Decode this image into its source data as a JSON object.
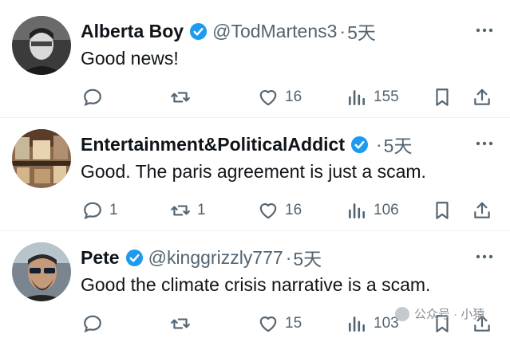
{
  "tweets": [
    {
      "name": "Alberta Boy",
      "handle": "@TodMartens3",
      "separator": "·",
      "time": "5天",
      "text": "Good news!",
      "replies": "",
      "retweets": "",
      "likes": "16",
      "views": "155"
    },
    {
      "name": "Entertainment&PoliticalAddict",
      "handle": "",
      "separator": "·",
      "time": "5天",
      "text": "Good. The paris agreement is just a scam.",
      "replies": "1",
      "retweets": "1",
      "likes": "16",
      "views": "106"
    },
    {
      "name": "Pete",
      "handle": "@kinggrizzly777",
      "separator": "·",
      "time": "5天",
      "text": "Good the climate crisis narrative is a scam.",
      "replies": "",
      "retweets": "",
      "likes": "15",
      "views": "103"
    }
  ],
  "watermark": "公众号 · 小猿",
  "colors": {
    "verified": "#1d9bf0",
    "text": "#0f1419",
    "secondary": "#536471",
    "divider": "#eff3f4"
  },
  "icons": [
    "verified-badge-icon",
    "more-icon",
    "reply-icon",
    "retweet-icon",
    "like-icon",
    "views-icon",
    "bookmark-icon",
    "share-icon"
  ]
}
